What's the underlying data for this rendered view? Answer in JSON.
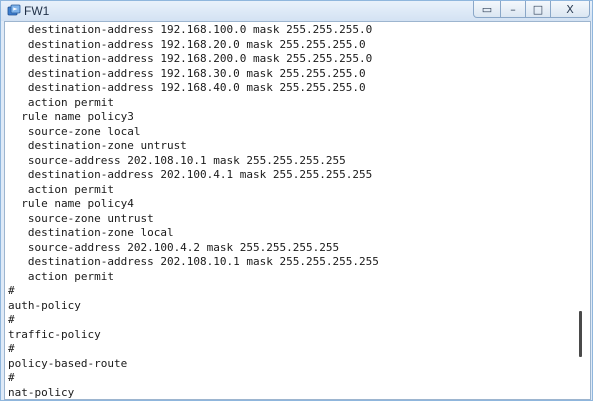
{
  "window": {
    "title": "FW1",
    "buttons": {
      "restore": "▭",
      "minimize": "–",
      "maximize": "□",
      "close": "X"
    }
  },
  "terminal": {
    "lines": [
      "   destination-address 192.168.100.0 mask 255.255.255.0",
      "   destination-address 192.168.20.0 mask 255.255.255.0",
      "   destination-address 192.168.200.0 mask 255.255.255.0",
      "   destination-address 192.168.30.0 mask 255.255.255.0",
      "   destination-address 192.168.40.0 mask 255.255.255.0",
      "   action permit",
      "  rule name policy3",
      "   source-zone local",
      "   destination-zone untrust",
      "   source-address 202.108.10.1 mask 255.255.255.255",
      "   destination-address 202.100.4.1 mask 255.255.255.255",
      "   action permit",
      "  rule name policy4",
      "   source-zone untrust",
      "   destination-zone local",
      "   source-address 202.100.4.2 mask 255.255.255.255",
      "   destination-address 202.108.10.1 mask 255.255.255.255",
      "   action permit",
      "#",
      "auth-policy",
      "#",
      "traffic-policy",
      "#",
      "policy-based-route",
      "#",
      "nat-policy"
    ]
  },
  "scroll": {
    "position_fraction": 0.9
  }
}
